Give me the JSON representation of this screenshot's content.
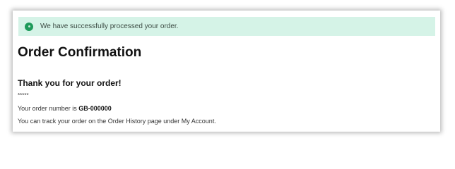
{
  "alert": {
    "message": "We have successfully processed your order.",
    "icon": "success-icon",
    "background": "#d5f3e7",
    "icon_color": "#1e9a5a"
  },
  "page": {
    "title": "Order Confirmation",
    "thank_you": "Thank you for your order!",
    "stars": "*****",
    "order_number_prefix": "Your order number is ",
    "order_number": "GB-000000",
    "track_message": "You can track your order on the Order History page under My Account."
  }
}
